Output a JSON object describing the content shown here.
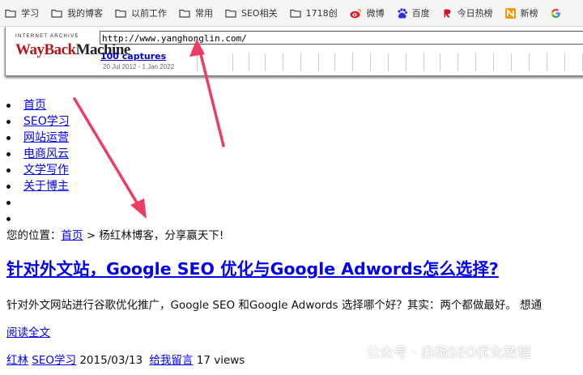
{
  "bookmarks": [
    {
      "label": "学习",
      "icon": "folder-icon"
    },
    {
      "label": "我的博客",
      "icon": "folder-icon"
    },
    {
      "label": "以前工作",
      "icon": "folder-icon"
    },
    {
      "label": "常用",
      "icon": "folder-icon"
    },
    {
      "label": "SEO相关",
      "icon": "folder-icon"
    },
    {
      "label": "1718创",
      "icon": "folder-icon"
    },
    {
      "label": "微博",
      "icon": "weibo-icon"
    },
    {
      "label": "百度",
      "icon": "baidu-icon"
    },
    {
      "label": "今日热榜",
      "icon": "rebang-icon"
    },
    {
      "label": "新榜",
      "icon": "xinbang-icon"
    },
    {
      "label": "G",
      "icon": "google-icon"
    }
  ],
  "wayback": {
    "brand_top": "INTERNET ARCHIVE",
    "logo_way": "WayBack",
    "logo_machine": "Machine",
    "url": "http://www.yanghonglin.com/",
    "captures": "100 captures",
    "date_range": "20 Jul 2012 - 1 Jan 2022"
  },
  "nav": [
    "首页",
    "SEO学习",
    "网站运营",
    "电商风云",
    "文学写作",
    "关于博主"
  ],
  "breadcrumb": {
    "prefix": "您的位置：",
    "home": "首页",
    "separator": " > ",
    "current": "杨红林博客，分享赢天下!"
  },
  "post": {
    "title": "针对外文站，Google SEO 优化与Google Adwords怎么选择?",
    "excerpt": "针对外文网站进行谷歌优化推广，Google SEO 和Google Adwords 选择哪个好？其实：两个都做最好。   想通",
    "read_more": "阅读全文",
    "author": "红林",
    "category": "SEO学习",
    "date": "2015/03/13",
    "comment": "给我留言",
    "views": "17 views"
  },
  "watermark": {
    "text": "公众号 · 白杨SEO优化教程",
    "icon": "wechat-icon"
  },
  "colors": {
    "link": "#0000ee",
    "arrow": "#ec3d62",
    "wayback_red": "#b3181d"
  }
}
